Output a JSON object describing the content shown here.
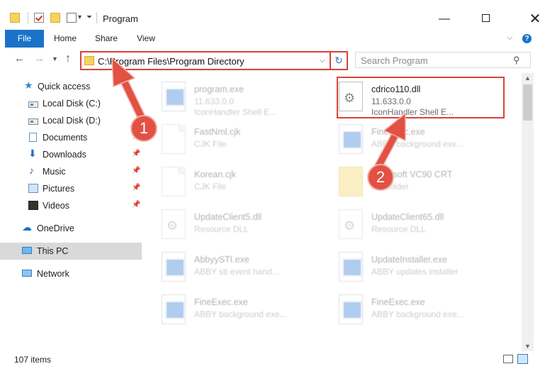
{
  "window": {
    "title": "Program",
    "minimize_glyph": "—",
    "close_glyph": "✕"
  },
  "ribbon": {
    "tabs": [
      "File",
      "Home",
      "Share",
      "View"
    ],
    "accent_color": "#1a73c8",
    "help_glyph": "?"
  },
  "navigation": {
    "address": "C:\\Program Files\\Program Directory",
    "search_placeholder": "Search Program"
  },
  "sidebar": {
    "items": [
      {
        "label": "Quick access",
        "icon": "star-icon"
      },
      {
        "label": "Local Disk (C:)",
        "icon": "drive-icon"
      },
      {
        "label": "Local Disk (D:)",
        "icon": "drive-icon"
      },
      {
        "label": "Documents",
        "icon": "documents-icon",
        "pinned": true
      },
      {
        "label": "Downloads",
        "icon": "download-icon",
        "pinned": true
      },
      {
        "label": "Music",
        "icon": "music-icon",
        "pinned": true
      },
      {
        "label": "Pictures",
        "icon": "pictures-icon",
        "pinned": true
      },
      {
        "label": "Videos",
        "icon": "videos-icon",
        "pinned": true
      },
      {
        "label": "OneDrive",
        "icon": "cloud-icon"
      },
      {
        "label": "This PC",
        "icon": "computer-icon",
        "selected": true
      },
      {
        "label": "Network",
        "icon": "network-icon"
      }
    ]
  },
  "files": [
    {
      "name": "program.exe",
      "line2": "11.633.0.0",
      "line3": "IconHandler Shell E...",
      "icon": "exe-icon",
      "highlighted": false
    },
    {
      "name": "cdrico110.dll",
      "line2": "11.633.0.0",
      "line3": "IconHandler Shell E...",
      "icon": "dll-icon",
      "highlighted": true
    },
    {
      "name": "FastNml.cjk",
      "line2": "CJK File",
      "line3": "",
      "icon": "generic-file-icon",
      "highlighted": false
    },
    {
      "name": "FineExec.exe",
      "line2": "ABBY background exe...",
      "line3": "",
      "icon": "exe-icon",
      "highlighted": false
    },
    {
      "name": "Korean.cjk",
      "line2": "CJK File",
      "line3": "",
      "icon": "generic-file-icon",
      "highlighted": false
    },
    {
      "name": "Microsoft VC90 CRT",
      "line2": "File folder",
      "line3": "",
      "icon": "folder-icon",
      "highlighted": false
    },
    {
      "name": "UpdateClient5.dll",
      "line2": "Resource DLL",
      "line3": "",
      "icon": "dll-icon",
      "highlighted": false
    },
    {
      "name": "UpdateClient65.dll",
      "line2": "Resource DLL",
      "line3": "",
      "icon": "dll-icon",
      "highlighted": false
    },
    {
      "name": "AbbyySTI.exe",
      "line2": "ABBY sti event hand...",
      "line3": "",
      "icon": "exe-icon",
      "highlighted": false
    },
    {
      "name": "UpdateInstaller.exe",
      "line2": "ABBY updates installer",
      "line3": "",
      "icon": "exe-icon",
      "highlighted": false
    },
    {
      "name": "FineExec.exe",
      "line2": "ABBY background exe...",
      "line3": "",
      "icon": "exe-icon",
      "highlighted": false
    },
    {
      "name": "FineExec.exe",
      "line2": "ABBY background exe...",
      "line3": "",
      "icon": "exe-icon",
      "highlighted": false
    }
  ],
  "annotations": {
    "step1": "1",
    "step2": "2",
    "color": "#e25143"
  },
  "status": {
    "item_count": "107 items"
  }
}
